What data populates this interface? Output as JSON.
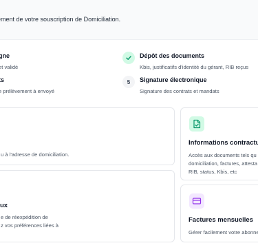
{
  "banner": {
    "text": "ement de votre souscription de Domiciliation."
  },
  "steps": [
    {
      "title": "gne",
      "desc": "et validé",
      "status": "done"
    },
    {
      "title": "ts",
      "desc": "e prélèvement à envoyé",
      "status": "done"
    },
    {
      "title": "Dépôt des documents",
      "desc": "Kbis, justificatifs d'identité du gérant, RIB reçus",
      "status": "done",
      "icon": "check-icon"
    },
    {
      "title": "Signature électronique",
      "desc": "Signature des contrats et mandats",
      "status": "pending",
      "number": "5"
    }
  ],
  "cards": {
    "mail": {
      "text": "u à l'adresse de domiciliation."
    },
    "forwarding": {
      "title": "ux",
      "line1": "e de réexpédition de",
      "line2": "z vos préférences liées à"
    },
    "contract": {
      "title": "Informations contractue",
      "line1": "Accès aux documents tels qu",
      "line2": "domiciliation, factures, attesta",
      "line3": "RIB, status, Kbis, etc",
      "icon": "document-check-icon",
      "accent": "#059669",
      "tile_bg": "#d1fae5"
    },
    "invoices": {
      "title": "Factures mensuelles",
      "line1": "Gérer facilement votre abonne",
      "icon": "credit-card-icon",
      "accent": "#9333ea",
      "tile_bg": "#f3e8ff"
    }
  }
}
